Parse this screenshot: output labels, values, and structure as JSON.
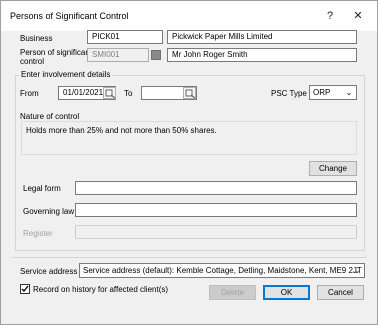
{
  "window": {
    "title": "Persons of Significant Control",
    "help_label": "?",
    "close_label": "✕"
  },
  "business": {
    "label": "Business",
    "code": "PICK01",
    "name": "Pickwick Paper Mills Limited"
  },
  "person": {
    "label_line1": "Person of significant",
    "label_line2": "control",
    "code": "SMI001",
    "name": "Mr John Roger Smith"
  },
  "involvement": {
    "group_title": "Enter involvement details",
    "from_label": "From",
    "from_value": "01/01/2021",
    "to_label": "To",
    "to_value": "",
    "psc_type_label": "PSC Type",
    "psc_type_value": "ORP",
    "nature_label": "Nature of control",
    "nature_value": "Holds more than 25% and not more than 50% shares.",
    "change_button": "Change"
  },
  "legal_form": {
    "label": "Legal form",
    "value": ""
  },
  "governing_law": {
    "label": "Governing law",
    "value": ""
  },
  "register": {
    "label": "Register",
    "value": ""
  },
  "service_address": {
    "label": "Service address",
    "value": "Service address (default): Kemble Cottage, Detling, Maidstone, Kent, ME9 2JT"
  },
  "record_history": {
    "label": "Record on history for affected client(s)",
    "checked": true
  },
  "buttons": {
    "delete": "Delete",
    "ok": "OK",
    "cancel": "Cancel"
  },
  "icons": {
    "calendar": "calendar-icon",
    "lookup": "lookup-icon",
    "dropdown": "chevron-down-icon",
    "check": "check-icon"
  }
}
